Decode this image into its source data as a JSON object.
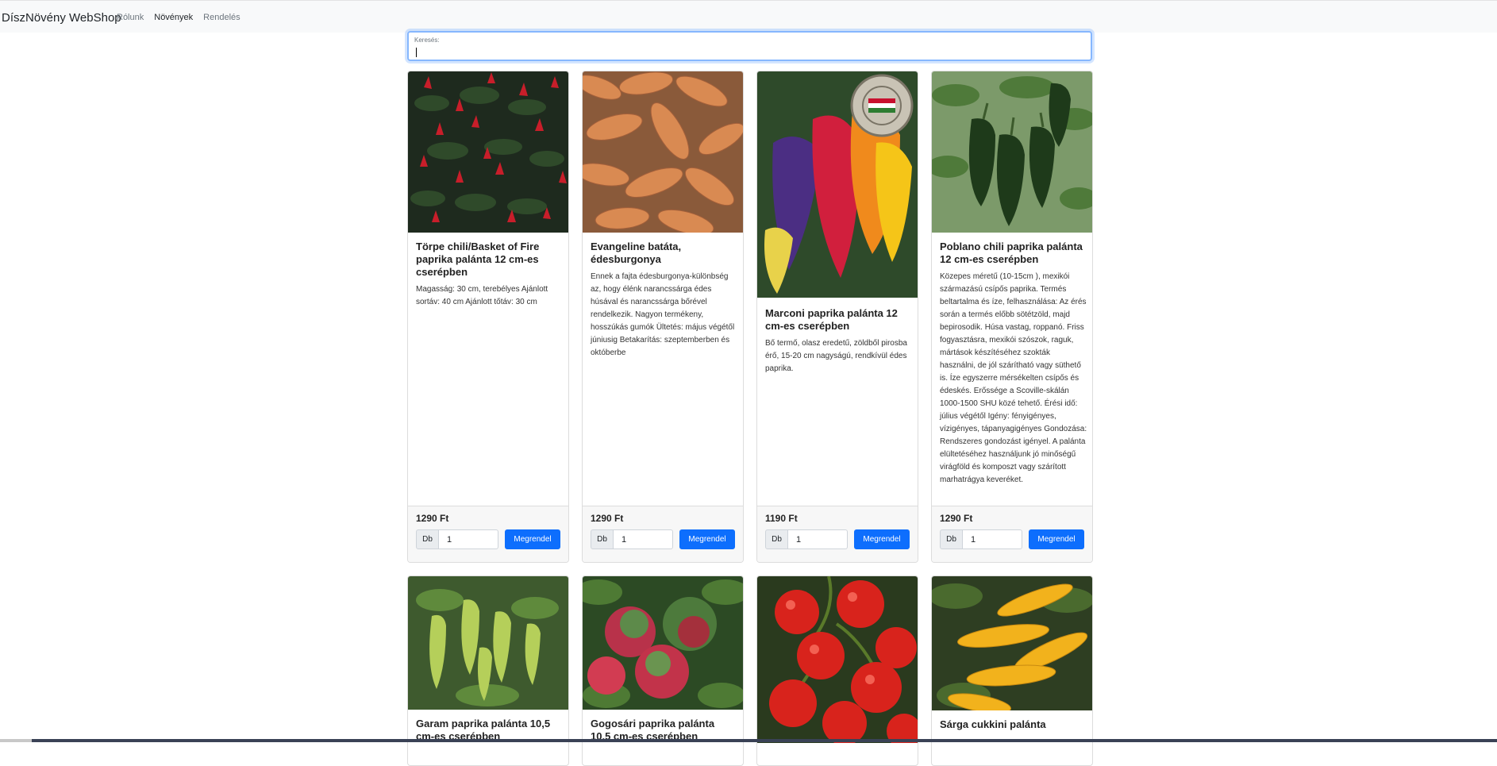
{
  "navbar": {
    "brand": "DíszNövény WebShop",
    "links": [
      "Rólunk",
      "Növények",
      "Rendelés"
    ]
  },
  "search": {
    "label": "Keresés:",
    "value": ""
  },
  "colors": {
    "primary": "#0d6efd",
    "navbar_bg": "#f8f9fa",
    "focus_border": "#86b7fe"
  },
  "products": [
    {
      "image": "red-chili-plant",
      "title": "Törpe chili/Basket of Fire paprika palánta 12 cm-es cserépben",
      "description": "Magasság: 30 cm, terebélyes Ajánlott sortáv: 40 cm Ajánlott tőtáv: 30 cm",
      "price": "1290 Ft",
      "qty_label": "Db",
      "qty_value": "1",
      "button": "Megrendel"
    },
    {
      "image": "sweet-potatoes",
      "title": "Evangeline batáta, édesburgonya",
      "description": "Ennek a fajta édesburgonya-különbség az, hogy élénk narancssárga édes húsával és narancssárga bőrével rendelkezik. Nagyon termékeny, hosszúkás gumók Ültetés: május végétől júniusig Betakarítás: szeptemberben és októberbe",
      "price": "1290 Ft",
      "qty_label": "Db",
      "qty_value": "1",
      "button": "Megrendel"
    },
    {
      "image": "marconi-peppers",
      "title": "Marconi paprika palánta 12 cm-es cserépben",
      "description": "Bő termő, olasz eredetű, zöldből pirosba érő, 15-20 cm nagyságú, rendkívül édes paprika.",
      "price": "1190 Ft",
      "qty_label": "Db",
      "qty_value": "1",
      "button": "Megrendel"
    },
    {
      "image": "poblano-peppers",
      "title": "Poblano chili paprika palánta 12 cm-es cserépben",
      "description": "Közepes méretű (10-15cm ), mexikói származású csípős paprika. Termés beltartalma és íze, felhasználása: Az érés során a termés előbb sötétzöld, majd bepirosodik. Húsa vastag, roppanó. Friss fogyasztásra, mexikói szószok, raguk, mártások készítéséhez szokták használni, de jól szárítható vagy süthető is. Íze egyszerre mérsékelten csípős és édeskés. Erőssége a Scoville-skálán 1000-1500 SHU közé tehető. Érési idő: július végétől Igény: fényigényes, vízigényes, tápanyagigényes Gondozása: Rendszeres gondozást igényel. A palánta elültetéséhez használjunk jó minőségű virágföld és komposzt vagy szárított marhatrágya keveréket.",
      "price": "1290 Ft",
      "qty_label": "Db",
      "qty_value": "1",
      "button": "Megrendel"
    },
    {
      "image": "green-peppers",
      "title": "Garam paprika palánta 10,5 cm-es cserépben"
    },
    {
      "image": "gogosari-peppers",
      "title": "Gogosári paprika palánta 10,5 cm-es cserépben"
    },
    {
      "image": "tomatoes",
      "title": ""
    },
    {
      "image": "yellow-zucchini",
      "title": "Sárga cukkini palánta"
    }
  ]
}
